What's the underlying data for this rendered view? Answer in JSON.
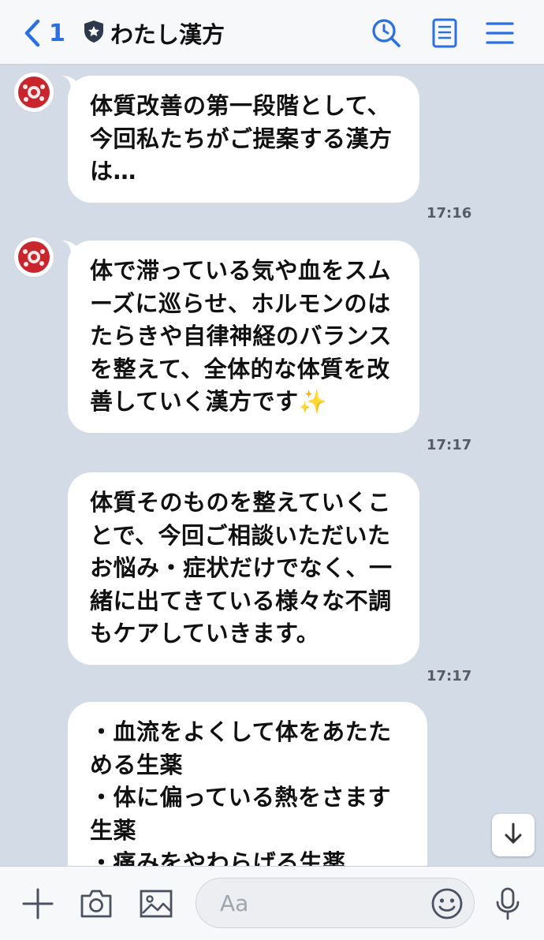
{
  "header": {
    "back_count": "1",
    "title": "わたし漢方",
    "accent_color": "#2b6fe0",
    "icons": [
      "chevron-left-icon",
      "shield-badge-icon",
      "search-history-icon",
      "notes-icon",
      "menu-icon"
    ]
  },
  "messages": [
    {
      "text": "体質改善の第一段階として、\n今回私たちがご提案する漢方は…",
      "time": "17:16",
      "show_avatar": true
    },
    {
      "text": "体で滞っている気や血をスムーズに巡らせ、ホルモンのはたらきや自律神経のバランスを整えて、全体的な体質を改善していく漢方です✨",
      "time": "17:17",
      "show_avatar": true
    },
    {
      "text": "体質そのものを整えていくことで、今回ご相談いただいたお悩み・症状だけでなく、一緒に出てきている様々な不調もケアしていきます。",
      "time": "17:17",
      "show_avatar": false
    },
    {
      "text": "・血流をよくして体をあたためる生薬\n・体に偏っている熱をさます生薬\n・痛みをやわらげる生薬",
      "time": "",
      "show_avatar": false
    }
  ],
  "footer": {
    "input_placeholder": "Aa",
    "icons": [
      "plus-icon",
      "camera-icon",
      "image-icon",
      "emoji-icon",
      "microphone-icon"
    ]
  },
  "scroll_down_icon": "arrow-down-icon",
  "colors": {
    "chat_background": "#d3dce6",
    "bubble": "#ffffff",
    "avatar_red": "#c8262c"
  }
}
